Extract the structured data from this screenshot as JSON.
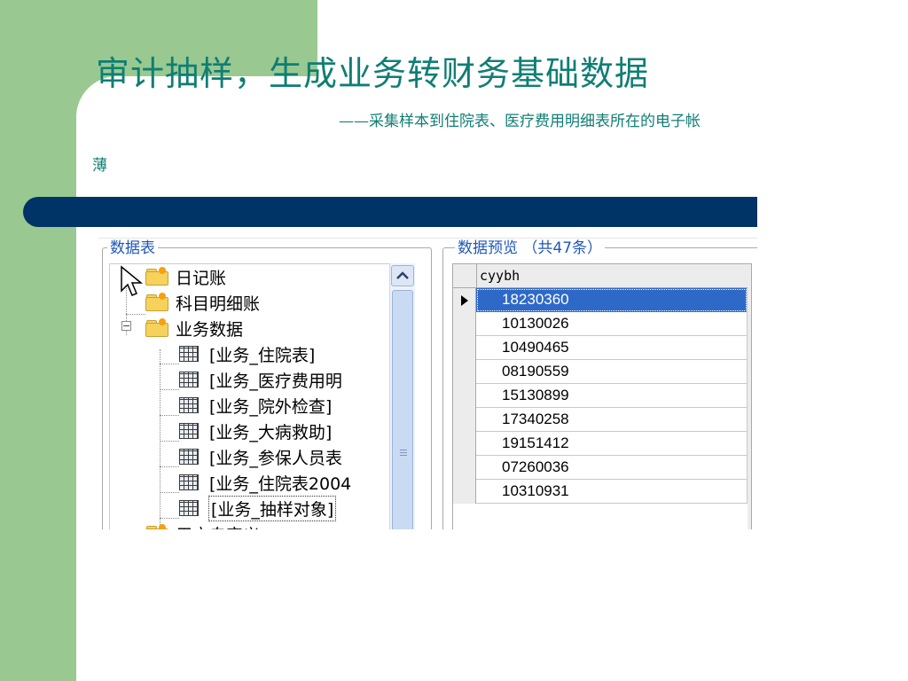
{
  "slide": {
    "title": "审计抽样，生成业务转财务基础数据",
    "subtitle_line1": "——采集样本到住院表、医疗费用明细表所在的电子帐",
    "subtitle_line2": "薄"
  },
  "panels": {
    "tree_label": "数据表",
    "preview_label": "数据预览 （共47条）"
  },
  "tree": {
    "items": [
      {
        "label": "日记账",
        "icon": "folder-icon"
      },
      {
        "label": "科目明细账",
        "icon": "folder-icon"
      },
      {
        "label": "业务数据",
        "icon": "folder-icon",
        "expander": "−"
      },
      {
        "label": "[业务_住院表]",
        "icon": "table-icon"
      },
      {
        "label": "[业务_医疗费用明",
        "icon": "table-icon"
      },
      {
        "label": "[业务_院外检查]",
        "icon": "table-icon"
      },
      {
        "label": "[业务_大病救助]",
        "icon": "table-icon"
      },
      {
        "label": "[业务_参保人员表",
        "icon": "table-icon"
      },
      {
        "label": "[业务_住院表2004",
        "icon": "table-icon"
      },
      {
        "label": "[业务_抽样对象]",
        "icon": "table-icon",
        "selected": true
      },
      {
        "label": "用户自定义",
        "icon": "folder-icon"
      }
    ]
  },
  "grid": {
    "column": "cyybh",
    "rows": [
      "18230360",
      "10130026",
      "10490465",
      "08190559",
      "15130899",
      "17340258",
      "19151412",
      "07260036",
      "10310931"
    ],
    "selected_index": 0
  },
  "colors": {
    "title_teal": "#0f7e74",
    "side_green": "#99c991",
    "band_navy": "#003366",
    "selection_blue": "#2f69c8"
  }
}
